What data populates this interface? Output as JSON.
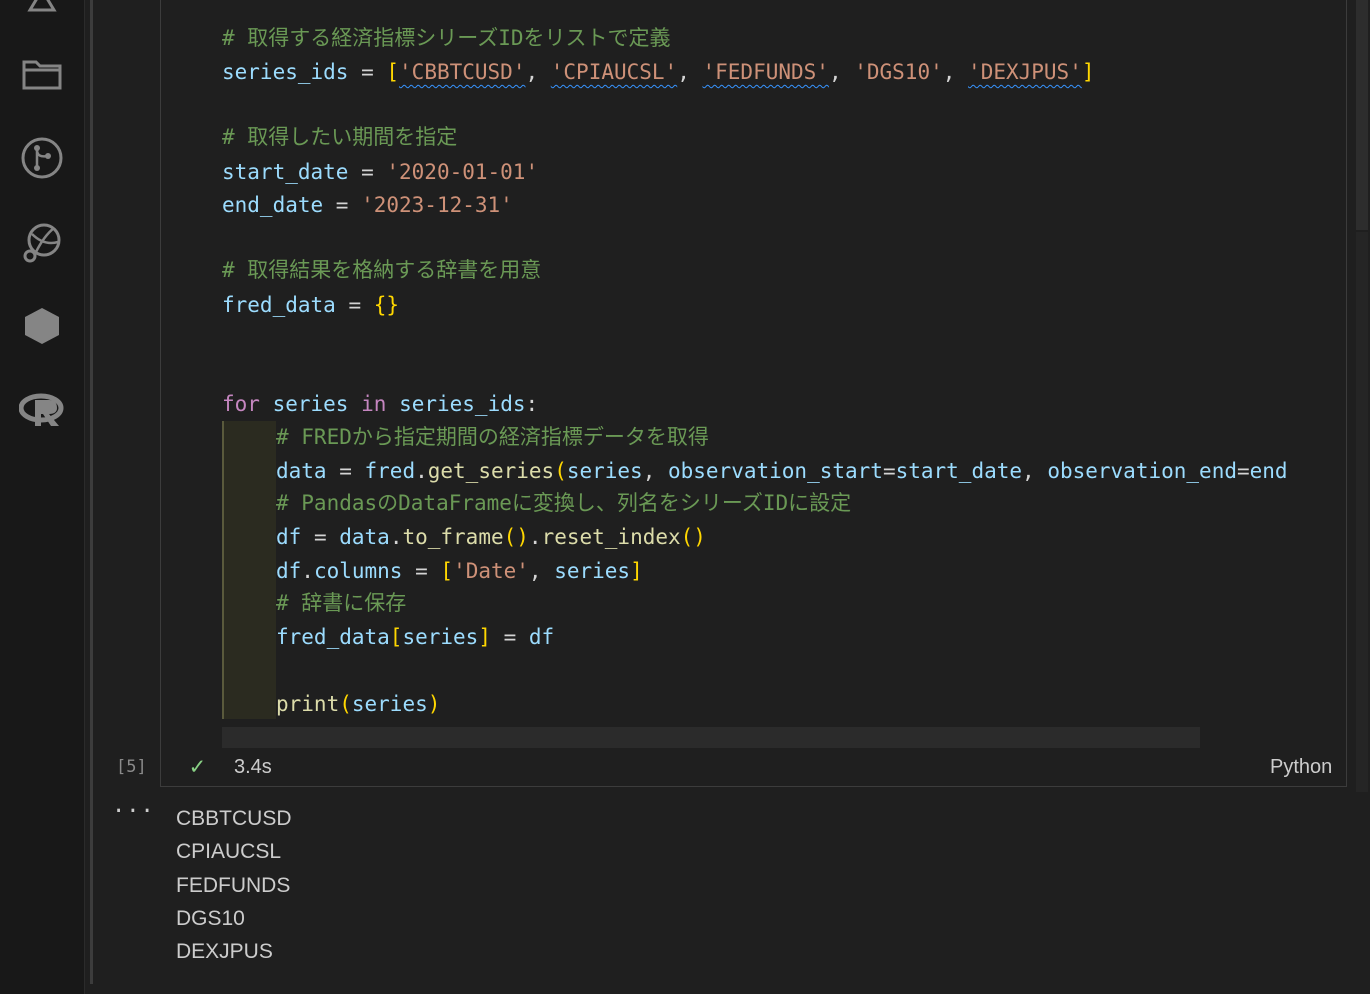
{
  "activity_bar": {
    "icons": [
      "search-icon",
      "explorer-icon",
      "source-control-icon",
      "remote-explorer-icon",
      "extensions-icon",
      "r-language-icon"
    ]
  },
  "cell": {
    "execution_count": "[5]",
    "status_icon": "✓",
    "duration": "3.4s",
    "language": "Python",
    "code": {
      "line1_comment": "# 取得する経済指標シリーズIDをリストで定義",
      "line2": {
        "var": "series_ids",
        "op": " = ",
        "ids": [
          "'CBBTCUSD'",
          "'CPIAUCSL'",
          "'FEDFUNDS'",
          "'DGS10'",
          "'DEXJPUS'"
        ]
      },
      "line3_comment": "# 取得したい期間を指定",
      "line4": {
        "var": "start_date",
        "op": " = ",
        "value": "'2020-01-01'"
      },
      "line5": {
        "var": "end_date",
        "op": " = ",
        "value": "'2023-12-31'"
      },
      "line6_comment": "# 取得結果を格納する辞書を用意",
      "line7": {
        "var": "fred_data",
        "op": " = ",
        "value": "{}"
      },
      "line8": {
        "kw_for": "for",
        "var": "series",
        "kw_in": "in",
        "iter": "series_ids",
        "colon": ":"
      },
      "line9_comment": "# FREDから指定期間の経済指標データを取得",
      "line10": {
        "var": "data",
        "obj": "fred",
        "fn": "get_series",
        "arg1": "series",
        "kw1": "observation_start",
        "val1": "start_date",
        "kw2": "observation_end",
        "val2": "end"
      },
      "line11_comment": "# PandasのDataFrameに変換し、列名をシリーズIDに設定",
      "line12": {
        "var": "df",
        "src": "data",
        "fn1": "to_frame",
        "fn2": "reset_index"
      },
      "line13": {
        "var": "df",
        "attr": "columns",
        "str": "'Date'",
        "item": "series"
      },
      "line14_comment": "# 辞書に保存",
      "line15": {
        "var": "fred_data",
        "key": "series",
        "value": "df"
      },
      "line16": {
        "fn": "print",
        "arg": "series"
      }
    }
  },
  "output": {
    "more_label": "···",
    "lines": [
      "CBBTCUSD",
      "CPIAUCSL",
      "FEDFUNDS",
      "DGS10",
      "DEXJPUS"
    ]
  }
}
